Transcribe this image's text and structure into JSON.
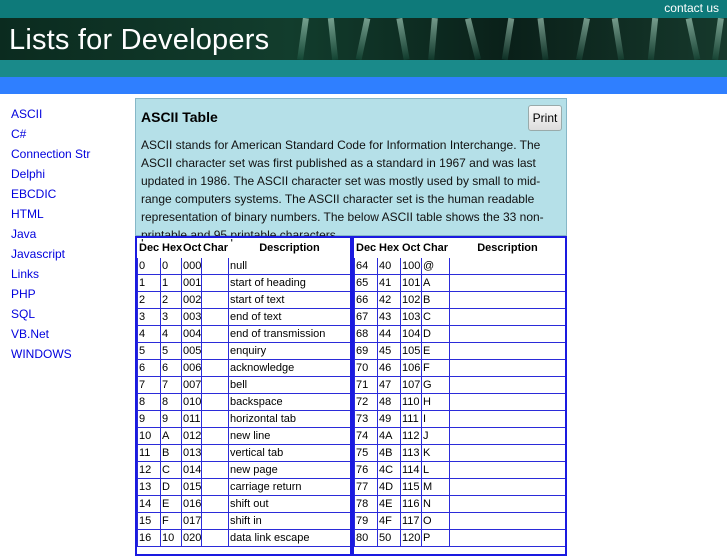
{
  "header": {
    "contact_label": "contact us",
    "site_title": "Lists for Developers"
  },
  "sidebar": {
    "items": [
      {
        "label": "ASCII"
      },
      {
        "label": "C#"
      },
      {
        "label": "Connection Str"
      },
      {
        "label": "Delphi"
      },
      {
        "label": "EBCDIC"
      },
      {
        "label": "HTML"
      },
      {
        "label": "Java"
      },
      {
        "label": "Javascript"
      },
      {
        "label": "Links"
      },
      {
        "label": "PHP"
      },
      {
        "label": "SQL"
      },
      {
        "label": "VB.Net"
      },
      {
        "label": "WINDOWS"
      }
    ]
  },
  "panel": {
    "title": "ASCII Table",
    "print_label": "Print",
    "description": "ASCII stands for American Standard Code for Information Interchange. The ASCII character set was first published as a standard in 1967 and was last updated in 1986. The ASCII character set was mostly used by small to mid-range computers systems. The ASCII character set is the human readable representation of binary numbers. The below ASCII table shows the 33 non-printable and 95 printable characters."
  },
  "table_left": {
    "headers": [
      "Dec",
      "Hex",
      "Oct",
      "Char",
      "Description"
    ],
    "rows": [
      [
        "0",
        "0",
        "000",
        "",
        "null"
      ],
      [
        "1",
        "1",
        "001",
        "",
        "start of heading"
      ],
      [
        "2",
        "2",
        "002",
        "",
        "start of text"
      ],
      [
        "3",
        "3",
        "003",
        "",
        "end of text"
      ],
      [
        "4",
        "4",
        "004",
        "",
        "end of transmission"
      ],
      [
        "5",
        "5",
        "005",
        "",
        "enquiry"
      ],
      [
        "6",
        "6",
        "006",
        "",
        "acknowledge"
      ],
      [
        "7",
        "7",
        "007",
        "",
        "bell"
      ],
      [
        "8",
        "8",
        "010",
        "",
        "backspace"
      ],
      [
        "9",
        "9",
        "011",
        "",
        "horizontal tab"
      ],
      [
        "10",
        "A",
        "012",
        "",
        "new line"
      ],
      [
        "11",
        "B",
        "013",
        "",
        "vertical tab"
      ],
      [
        "12",
        "C",
        "014",
        "",
        "new page"
      ],
      [
        "13",
        "D",
        "015",
        "",
        "carriage return"
      ],
      [
        "14",
        "E",
        "016",
        "",
        "shift out"
      ],
      [
        "15",
        "F",
        "017",
        "",
        "shift in"
      ],
      [
        "16",
        "10",
        "020",
        "",
        "data link escape"
      ]
    ]
  },
  "table_right": {
    "headers": [
      "Dec",
      "Hex",
      "Oct",
      "Char",
      "Description"
    ],
    "rows": [
      [
        "64",
        "40",
        "100",
        "@",
        ""
      ],
      [
        "65",
        "41",
        "101",
        "A",
        ""
      ],
      [
        "66",
        "42",
        "102",
        "B",
        ""
      ],
      [
        "67",
        "43",
        "103",
        "C",
        ""
      ],
      [
        "68",
        "44",
        "104",
        "D",
        ""
      ],
      [
        "69",
        "45",
        "105",
        "E",
        ""
      ],
      [
        "70",
        "46",
        "106",
        "F",
        ""
      ],
      [
        "71",
        "47",
        "107",
        "G",
        ""
      ],
      [
        "72",
        "48",
        "110",
        "H",
        ""
      ],
      [
        "73",
        "49",
        "111",
        "I",
        ""
      ],
      [
        "74",
        "4A",
        "112",
        "J",
        ""
      ],
      [
        "75",
        "4B",
        "113",
        "K",
        ""
      ],
      [
        "76",
        "4C",
        "114",
        "L",
        ""
      ],
      [
        "77",
        "4D",
        "115",
        "M",
        ""
      ],
      [
        "78",
        "4E",
        "116",
        "N",
        ""
      ],
      [
        "79",
        "4F",
        "117",
        "O",
        ""
      ],
      [
        "80",
        "50",
        "120",
        "P",
        ""
      ]
    ]
  }
}
